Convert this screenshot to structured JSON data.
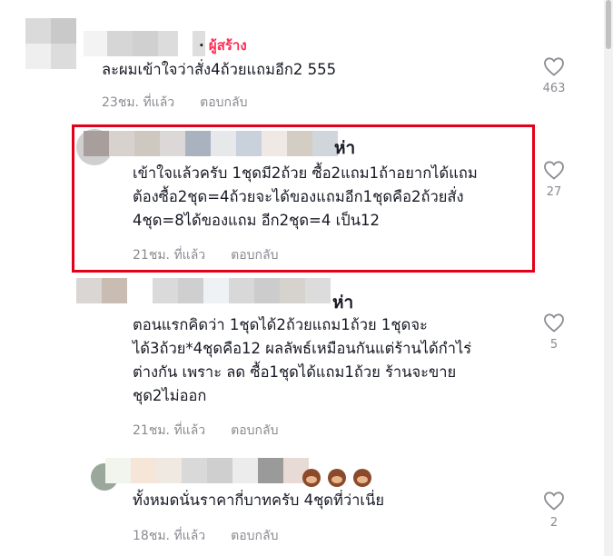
{
  "comments": [
    {
      "creator_label": "ผู้สร้าง",
      "lines": [
        "ละผมเข้าใจว่าสั่ง4ถ้วยแถมอีก2 555"
      ],
      "time": "23ชม. ที่แล้ว",
      "reply": "ตอบกลับ",
      "likes": "463"
    },
    {
      "name_tail": "ห่า",
      "lines": [
        "เข้าใจแล้วครับ 1ชุดมี2ถ้วย ซื้อ2แถม1ถ้าอยากได้แถม",
        "ต้องซื้อ2ชุด=4ถ้วยจะได้ของแถมอีก1ชุดคือ2ถ้วยสั่ง",
        "4ชุด=8ได้ของแถม อีก2ชุด=4 เป็น12"
      ],
      "time": "21ชม. ที่แล้ว",
      "reply": "ตอบกลับ",
      "likes": "27"
    },
    {
      "name_tail": "ห่า",
      "lines": [
        "ตอนแรกคิดว่า 1ชุดได้2ถ้วยแถม1ถ้วย 1ชุดจะ",
        "ได้3ถ้วย*4ชุดคือ12 ผลลัพธ์เหมือนกันแต่ร้านได้กำไร่",
        "ต่างกัน เพราะ ลด ซื้อ1ชุดได้แถม1ถ้วย ร้านจะขาย",
        "ชุด2ไม่ออก"
      ],
      "time": "21ชม. ที่แล้ว",
      "reply": "ตอบกลับ",
      "likes": "5"
    },
    {
      "lines": [
        "ทั้งหมดนั่นราคากี่บาทครับ 4ชุดที่ว่าเนี่ย"
      ],
      "time": "18ชม. ที่แล้ว",
      "reply": "ตอบกลับ",
      "likes": "2"
    }
  ],
  "icons": {
    "like": "heart-outline-icon",
    "emoji": "monkey-covering-eyes-icon"
  },
  "colors": {
    "creator": "#fe2c55",
    "highlight_box": "#e4001b",
    "meta": "#8a8b91"
  }
}
